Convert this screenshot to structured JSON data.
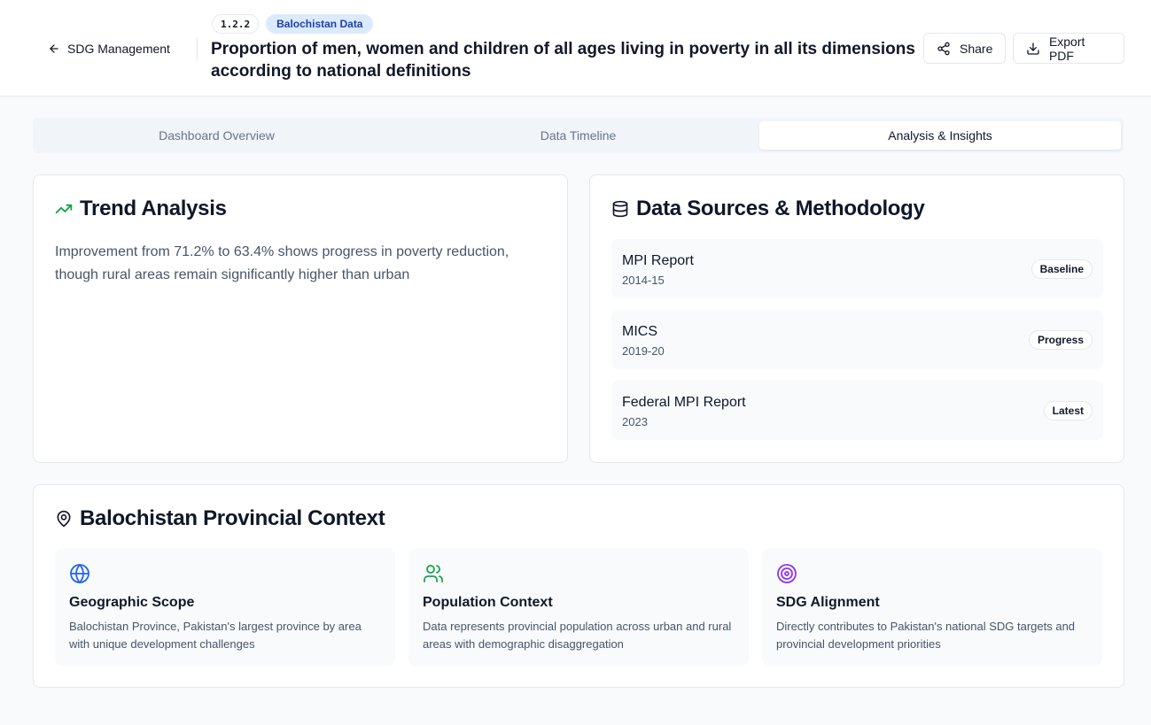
{
  "header": {
    "back_label": "SDG Management",
    "code": "1.2.2",
    "source_badge": "Balochistan Data",
    "title": "Proportion of men, women and children of all ages living in poverty in all its dimensions according to national definitions",
    "share_label": "Share",
    "export_label": "Export PDF"
  },
  "tabs": [
    {
      "label": "Dashboard Overview",
      "active": false
    },
    {
      "label": "Data Timeline",
      "active": false
    },
    {
      "label": "Analysis & Insights",
      "active": true
    }
  ],
  "trend": {
    "title": "Trend Analysis",
    "icon": "trending-up-icon",
    "text": "Improvement from 71.2% to 63.4% shows progress in poverty reduction, though rural areas remain significantly higher than urban"
  },
  "sources": {
    "title": "Data Sources & Methodology",
    "icon": "database-icon",
    "items": [
      {
        "name": "MPI Report",
        "year": "2014-15",
        "tag": "Baseline"
      },
      {
        "name": "MICS",
        "year": "2019-20",
        "tag": "Progress"
      },
      {
        "name": "Federal MPI Report",
        "year": "2023",
        "tag": "Latest"
      }
    ]
  },
  "context": {
    "title": "Balochistan Provincial Context",
    "icon": "map-pin-icon",
    "items": [
      {
        "title": "Geographic Scope",
        "icon": "globe-icon",
        "color": "#2563eb",
        "desc": "Balochistan Province, Pakistan's largest province by area with unique development challenges"
      },
      {
        "title": "Population Context",
        "icon": "users-icon",
        "color": "#16a34a",
        "desc": "Data represents provincial population across urban and rural areas with demographic disaggregation"
      },
      {
        "title": "SDG Alignment",
        "icon": "target-icon",
        "color": "#9333ea",
        "desc": "Directly contributes to Pakistan's national SDG targets and provincial development priorities"
      }
    ]
  },
  "colors": {
    "accent_green": "#16a34a",
    "badge_blue_bg": "#dbeafe",
    "badge_blue_text": "#1e40af"
  }
}
